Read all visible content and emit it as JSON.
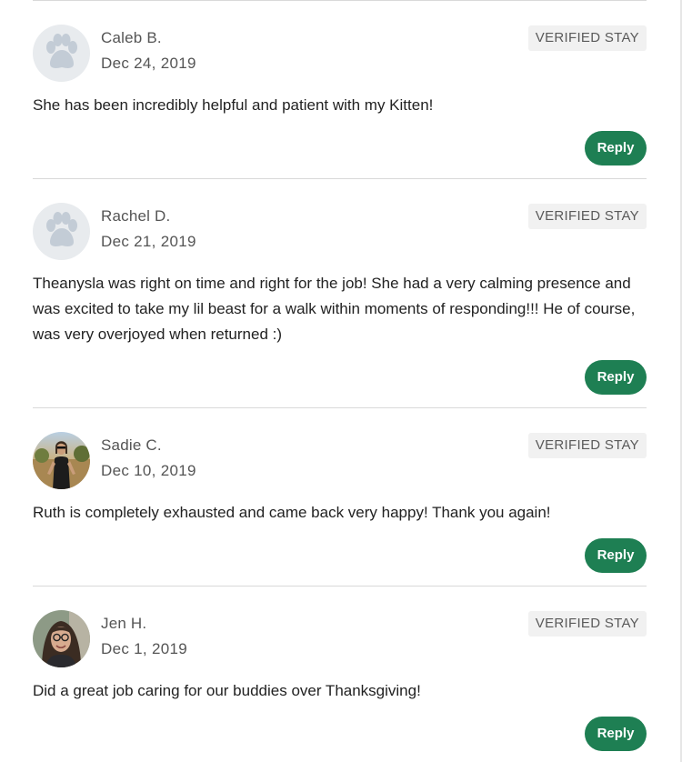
{
  "reviews": [
    {
      "name": "Caleb B.",
      "date": "Dec 24, 2019",
      "badge": "VERIFIED STAY",
      "text": "She has been incredibly helpful and patient with my Kitten!",
      "reply_label": "Reply",
      "avatar": "paw-icon"
    },
    {
      "name": "Rachel D.",
      "date": "Dec 21, 2019",
      "badge": "VERIFIED STAY",
      "text": "Theanysla was right on time and right for the job! She had a very calming presence and was excited to take my lil beast for a walk within moments of responding!!! He of course, was very overjoyed when returned :)",
      "reply_label": "Reply",
      "avatar": "paw-icon"
    },
    {
      "name": "Sadie C.",
      "date": "Dec 10, 2019",
      "badge": "VERIFIED STAY",
      "text": "Ruth is completely exhausted and came back very happy! Thank you again!",
      "reply_label": "Reply",
      "avatar": "user-photo"
    },
    {
      "name": "Jen H.",
      "date": "Dec 1, 2019",
      "badge": "VERIFIED STAY",
      "text": "Did a great job caring for our buddies over Thanksgiving!",
      "reply_label": "Reply",
      "avatar": "user-photo"
    }
  ],
  "colors": {
    "reply_button": "#1e7f53",
    "badge_bg": "#f1f1f1",
    "paw_avatar_bg": "#e8ebee",
    "paw_icon": "#c3ccd6"
  }
}
